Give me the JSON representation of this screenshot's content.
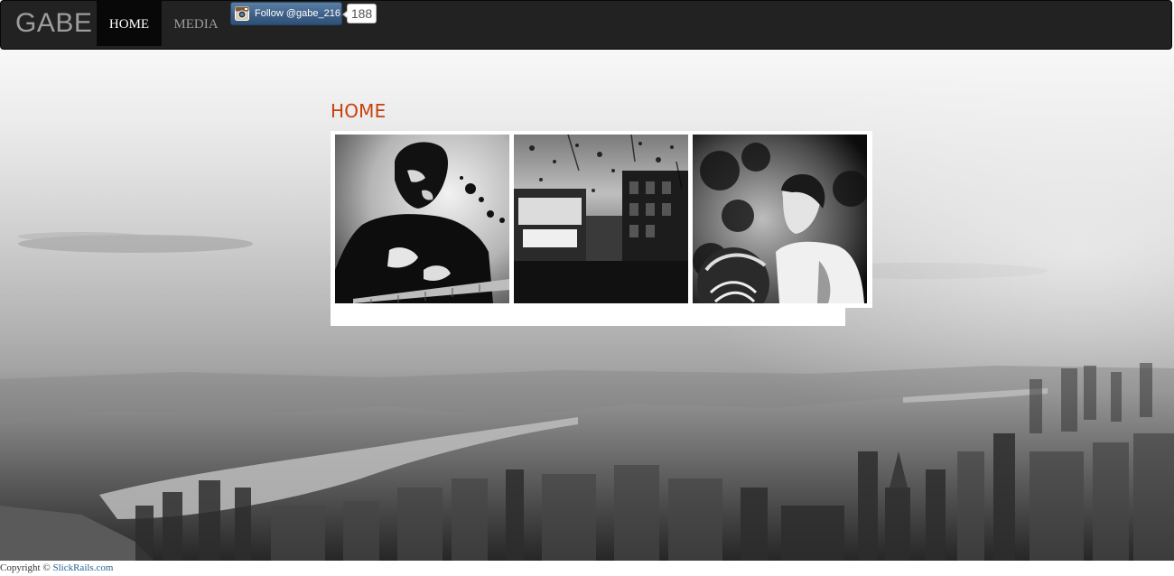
{
  "navbar": {
    "brand": "GABE",
    "items": [
      {
        "label": "HOME",
        "active": true
      },
      {
        "label": "MEDIA",
        "active": false
      }
    ],
    "instagram": {
      "follow_label": "Follow @gabe_216",
      "follower_count": "188",
      "icon": "instagram-camera-icon"
    }
  },
  "main": {
    "title": "HOME",
    "photos": [
      {
        "subject": "guitarist"
      },
      {
        "subject": "rainy-city-window"
      },
      {
        "subject": "football-player"
      }
    ]
  },
  "footer": {
    "copyright": "Copyright ©",
    "link_text": "SlickRails.com"
  },
  "colors": {
    "navbar_bg": "#222222",
    "title_accent": "#c8400c",
    "link": "#2a6496",
    "follow_button": "#3f6189"
  }
}
